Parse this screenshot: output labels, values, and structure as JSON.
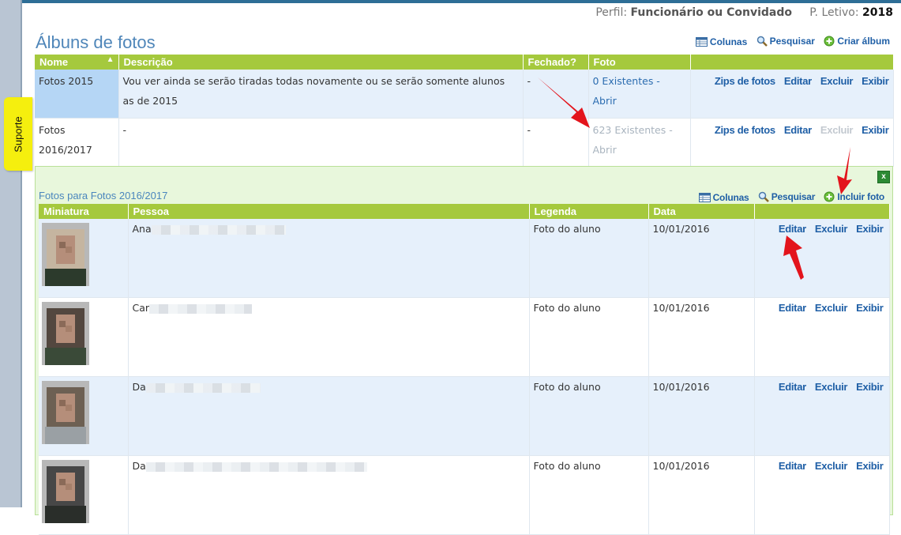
{
  "profile": {
    "label": "Perfil:",
    "value": "Funcionário ou Convidado",
    "year_label": "P. Letivo:",
    "year": "2018"
  },
  "support_tab": "Suporte",
  "page_title": "Álbuns de fotos",
  "albums_toolbar": {
    "columns": "Colunas",
    "search": "Pesquisar",
    "create": "Criar álbum"
  },
  "albums_table": {
    "headers": {
      "name": "Nome",
      "description": "Descrição",
      "closed": "Fechado?",
      "photo": "Foto"
    },
    "rows": [
      {
        "name": "Fotos 2015",
        "description": "Vou ver ainda se serão tiradas todas novamente ou se serão somente alunos as de 2015",
        "closed": "-",
        "photo": "0 Existentes - Abrir",
        "zips": "Zips de fotos",
        "edit": "Editar",
        "delete": "Excluir",
        "view": "Exibir"
      },
      {
        "name": "Fotos 2016/2017",
        "description": "-",
        "closed": "-",
        "photo": "623 Existentes - Abrir",
        "zips": "Zips de fotos",
        "edit": "Editar",
        "delete": "Excluir",
        "view": "Exibir"
      }
    ]
  },
  "close_button": "x",
  "photos_panel": {
    "title": "Fotos para Fotos 2016/2017",
    "toolbar": {
      "columns": "Colunas",
      "search": "Pesquisar",
      "add": "Incluir foto"
    },
    "headers": {
      "thumb": "Miniatura",
      "person": "Pessoa",
      "caption": "Legenda",
      "date": "Data"
    },
    "rows": [
      {
        "person": "Ana",
        "caption": "Foto do aluno",
        "date": "10/01/2016",
        "edit": "Editar",
        "delete": "Excluir",
        "view": "Exibir"
      },
      {
        "person": "Car",
        "caption": "Foto do aluno",
        "date": "10/01/2016",
        "edit": "Editar",
        "delete": "Excluir",
        "view": "Exibir"
      },
      {
        "person": "Da",
        "caption": "Foto do aluno",
        "date": "10/01/2016",
        "edit": "Editar",
        "delete": "Excluir",
        "view": "Exibir"
      },
      {
        "person": "Da",
        "caption": "Foto do aluno",
        "date": "10/01/2016",
        "edit": "Editar",
        "delete": "Excluir",
        "view": "Exibir"
      }
    ]
  },
  "colors": {
    "header_green": "#a5c93d",
    "link_blue": "#1f5fa6",
    "row_blue": "#e6f0fb",
    "panel_green": "#e8f7dc",
    "annotation_red": "#e3141c",
    "support_yellow": "#f5ef0e"
  }
}
